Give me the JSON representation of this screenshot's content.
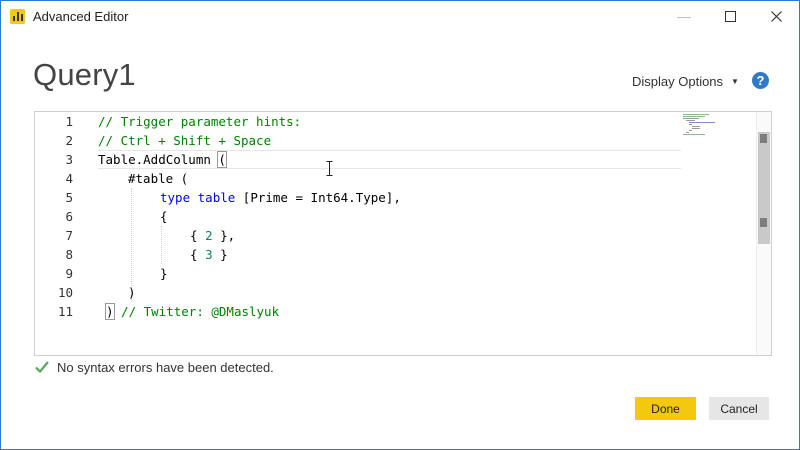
{
  "window": {
    "title": "Advanced Editor"
  },
  "header": {
    "query_name": "Query1",
    "display_options": "Display Options",
    "help": "?"
  },
  "editor": {
    "line_numbers": [
      "1",
      "2",
      "3",
      "4",
      "5",
      "6",
      "7",
      "8",
      "9",
      "10",
      "11"
    ],
    "line1": "// Trigger parameter hints:",
    "line2": "// Ctrl + Shift + Space",
    "line3_fn": "Table.AddColumn ",
    "line3_paren": "(",
    "line4": "#table (",
    "line5_kw1": "type",
    "line5_kw2": "table",
    "line5_rest": " [Prime = Int64.Type],",
    "line6": "{",
    "line7_open": "{ ",
    "line7_num": "2",
    "line7_close": " },",
    "line8_open": "{ ",
    "line8_num": "3",
    "line8_close": " }",
    "line9": "}",
    "line10": ")",
    "line11_paren": ")",
    "line11_comment": " // Twitter: @DMaslyuk"
  },
  "status": {
    "message": "No syntax errors have been detected."
  },
  "buttons": {
    "done": "Done",
    "cancel": "Cancel"
  },
  "colors": {
    "accent": "#f2c811",
    "comment": "#008000",
    "keyword": "#0000ff",
    "number": "#09885a",
    "check": "#5ba65b",
    "help": "#2d7bc8"
  }
}
